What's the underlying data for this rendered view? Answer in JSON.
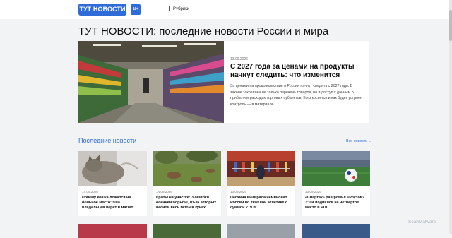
{
  "header": {
    "logo": "ТУТ НОВОСТИ",
    "age_badge": "18+",
    "rubrics_label": "Рубрики"
  },
  "page_title": "ТУТ НОВОСТИ: последние новости России и мира",
  "hero": {
    "date": "13.09.2026",
    "headline": "С 2027 года за ценами на продукты начнут следить: что изменится",
    "lead": "За ценами на продовольствие в России начнут следить с 2027 года. В законе закреплен не только перечень товаров, но и доступ к данным о прибыли и расходах торговых субъектов. Кого коснется и как будет устроен контроль — в материале."
  },
  "latest": {
    "title": "Последние новости",
    "all_link": "Все новости →",
    "cards": [
      {
        "date": "14.09.2026",
        "headline": "Почему кошка ложится на больное место: 50% владельцев верят в магию"
      },
      {
        "date": "14.09.2026",
        "headline": "Кроты на участке: 3 ошибки осенней борьбы, из-за которых весной весь газон в кучах"
      },
      {
        "date": "13.09.2026",
        "headline": "Пасхина выиграла чемпионат России по тяжелой атлетике с суммой 219 кг"
      },
      {
        "date": "13.09.2026",
        "headline": "«Спартак» разгромил «Ростов» 3:0 и поднялся на четвертое место в РПЛ"
      }
    ]
  },
  "watermark": "ScanMalware",
  "colors": {
    "accent": "#2f6cd8",
    "background": "#f2f3f5",
    "card": "#ffffff"
  }
}
